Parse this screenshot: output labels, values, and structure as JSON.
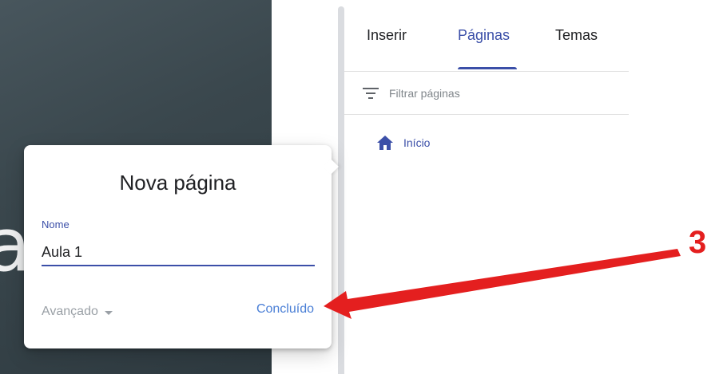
{
  "preview": {
    "partial_letter": "a"
  },
  "right_panel": {
    "tabs": [
      {
        "label": "Inserir",
        "active": false
      },
      {
        "label": "Páginas",
        "active": true
      },
      {
        "label": "Temas",
        "active": false
      }
    ],
    "filter": {
      "placeholder": "Filtrar páginas",
      "icon": "filter-icon"
    },
    "pages": [
      {
        "label": "Início",
        "icon": "home-icon"
      }
    ]
  },
  "dialog": {
    "title": "Nova página",
    "name_label": "Nome",
    "name_value": "Aula 1",
    "advanced_label": "Avançado",
    "done_label": "Concluído"
  },
  "annotation": {
    "number": "3",
    "color": "#e41f1f"
  },
  "colors": {
    "accent": "#3b4fa8",
    "link": "#4a7fd6",
    "preview_bg": "#3a474d"
  }
}
